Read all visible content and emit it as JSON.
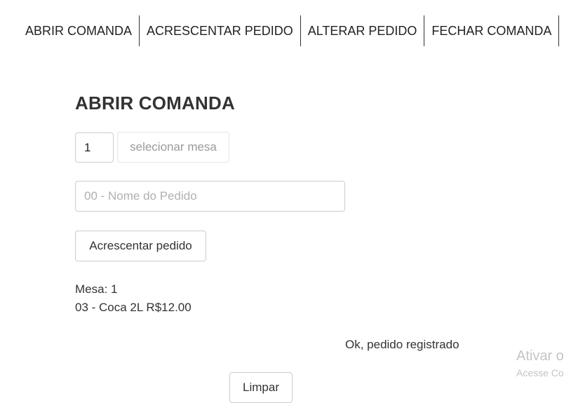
{
  "nav": {
    "items": [
      {
        "label": "ABRIR COMANDA"
      },
      {
        "label": "ACRESCENTAR PEDIDO"
      },
      {
        "label": "ALTERAR PEDIDO"
      },
      {
        "label": "FECHAR COMANDA"
      }
    ]
  },
  "main": {
    "title": "ABRIR COMANDA",
    "mesa_value": "1",
    "mesa_select_label": "selecionar mesa",
    "pedido_placeholder": "00 - Nome do Pedido",
    "add_button_label": "Acrescentar pedido",
    "mesa_line": "Mesa: 1",
    "item_line": "03 - Coca 2L R$12.00",
    "status_message": "Ok, pedido registrado",
    "clear_button_label": "Limpar"
  },
  "watermark": {
    "title": "Ativar o",
    "subtitle": "Acesse Co"
  }
}
